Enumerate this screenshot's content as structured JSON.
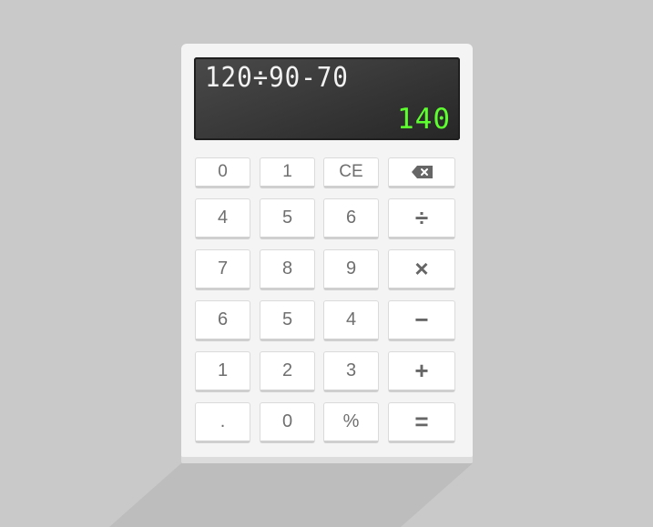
{
  "display": {
    "expression": "120÷90-70",
    "result": "140"
  },
  "colors": {
    "background": "#c9c9c9",
    "body": "#f4f4f4",
    "screen": "#333333",
    "expression_text": "#f2f2f2",
    "result_text": "#5dff2f"
  },
  "keys": {
    "row0": [
      "0",
      "1",
      "CE"
    ],
    "row0_op": "backspace-icon",
    "row1": [
      "4",
      "5",
      "6"
    ],
    "row1_op": "÷",
    "row2": [
      "7",
      "8",
      "9"
    ],
    "row2_op": "×",
    "row3": [
      "6",
      "5",
      "4"
    ],
    "row3_op": "−",
    "row4": [
      "1",
      "2",
      "3"
    ],
    "row4_op": "+",
    "row5": [
      ".",
      "0",
      "%"
    ],
    "row5_op": "="
  }
}
